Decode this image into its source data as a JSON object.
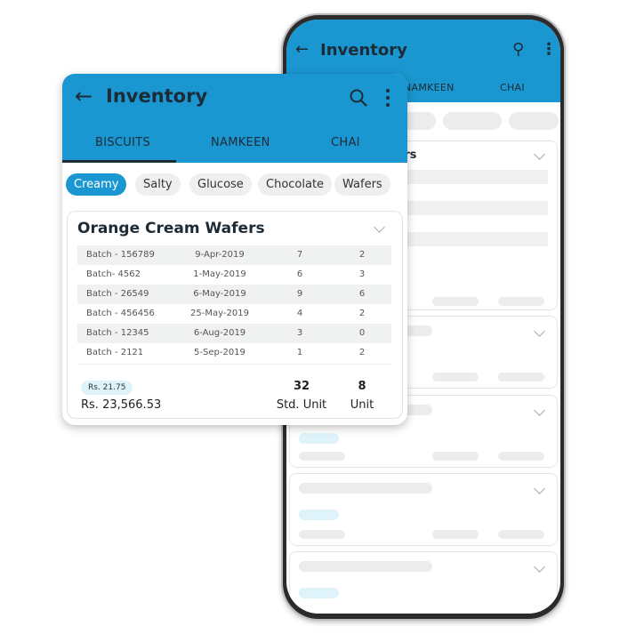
{
  "back_phone": {
    "title": "Inventory",
    "tabs": [
      "NAMKEEN",
      "CHAI"
    ],
    "card_title_partial": "afers"
  },
  "front": {
    "title": "Inventory",
    "tabs": [
      {
        "label": "BISCUITS",
        "active": true
      },
      {
        "label": "NAMKEEN"
      },
      {
        "label": "CHAI"
      }
    ],
    "chips": [
      {
        "label": "Creamy",
        "selected": true
      },
      {
        "label": "Salty"
      },
      {
        "label": "Glucose"
      },
      {
        "label": "Chocolate"
      },
      {
        "label": "Wafers"
      }
    ],
    "card": {
      "title": "Orange Cream Wafers",
      "rows": [
        {
          "batch": "Batch - 156789",
          "date": "9-Apr-2019",
          "std": "7",
          "unit": "2"
        },
        {
          "batch": "Batch- 4562",
          "date": "1-May-2019",
          "std": "6",
          "unit": "3"
        },
        {
          "batch": "Batch - 26549",
          "date": "6-May-2019",
          "std": "9",
          "unit": "6"
        },
        {
          "batch": "Batch - 456456",
          "date": "25-May-2019",
          "std": "4",
          "unit": "2"
        },
        {
          "batch": "Batch - 12345",
          "date": "6-Aug-2019",
          "std": "3",
          "unit": "0"
        },
        {
          "batch": "Batch - 2121",
          "date": "5-Sep-2019",
          "std": "1",
          "unit": "2"
        }
      ],
      "price_badge": "Rs. 21.75",
      "total": "Rs. 23,566.53",
      "std_total": "32",
      "std_label": "Std. Unit",
      "unit_total": "8",
      "unit_label": "Unit"
    }
  },
  "colors": {
    "accent": "#1a96d0",
    "text": "#1d2b36"
  }
}
